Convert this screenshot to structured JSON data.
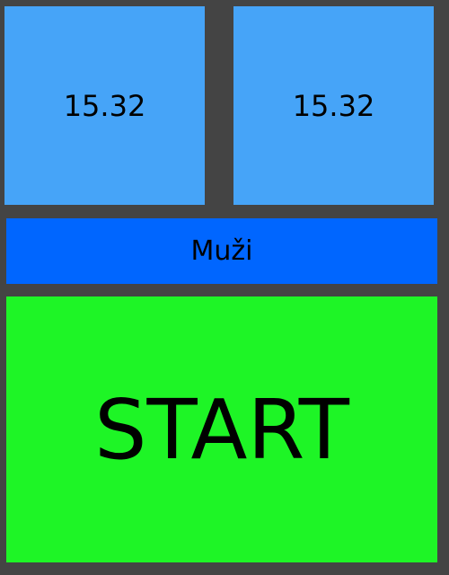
{
  "tiles": {
    "time_left": "15.32",
    "time_right": "15.32",
    "category": "Muži",
    "start": "START"
  },
  "colors": {
    "background": "#444444",
    "time_tile": "#46a4f8",
    "category_tile": "#0066ff",
    "start_tile": "#1ef526"
  }
}
